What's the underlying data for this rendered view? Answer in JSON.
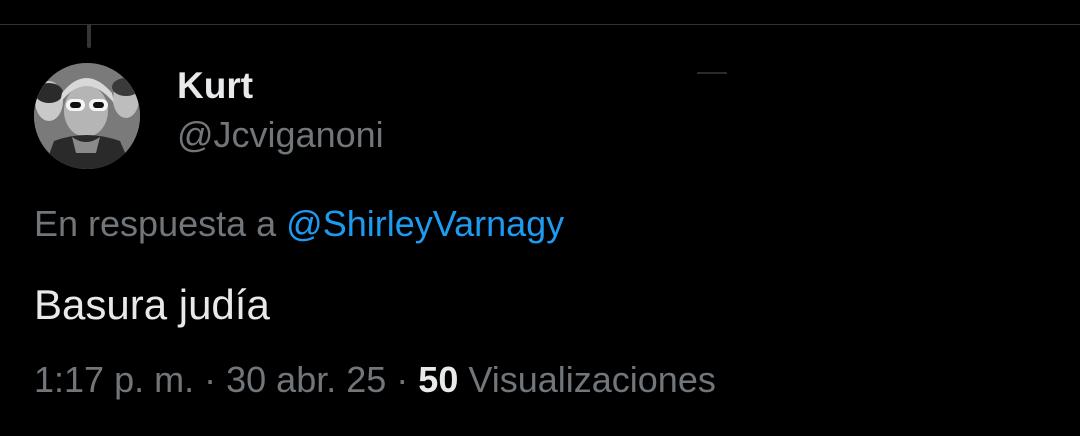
{
  "tweet": {
    "author": {
      "display_name": "Kurt",
      "handle": "@Jcviganoni",
      "avatar_icon": "avatar-photo-icon"
    },
    "reply": {
      "prefix": "En respuesta a",
      "mention": "@ShirleyVarnagy"
    },
    "text": "Basura judía",
    "meta": {
      "time": "1:17 p. m.",
      "separator": "·",
      "date": "30 abr. 25",
      "views_count": "50",
      "views_label": "Visualizaciones"
    }
  },
  "colors": {
    "background": "#000000",
    "primary_text": "#e7e9ea",
    "secondary_text": "#71767b",
    "link": "#1d9bf0",
    "border": "#2f3336"
  }
}
